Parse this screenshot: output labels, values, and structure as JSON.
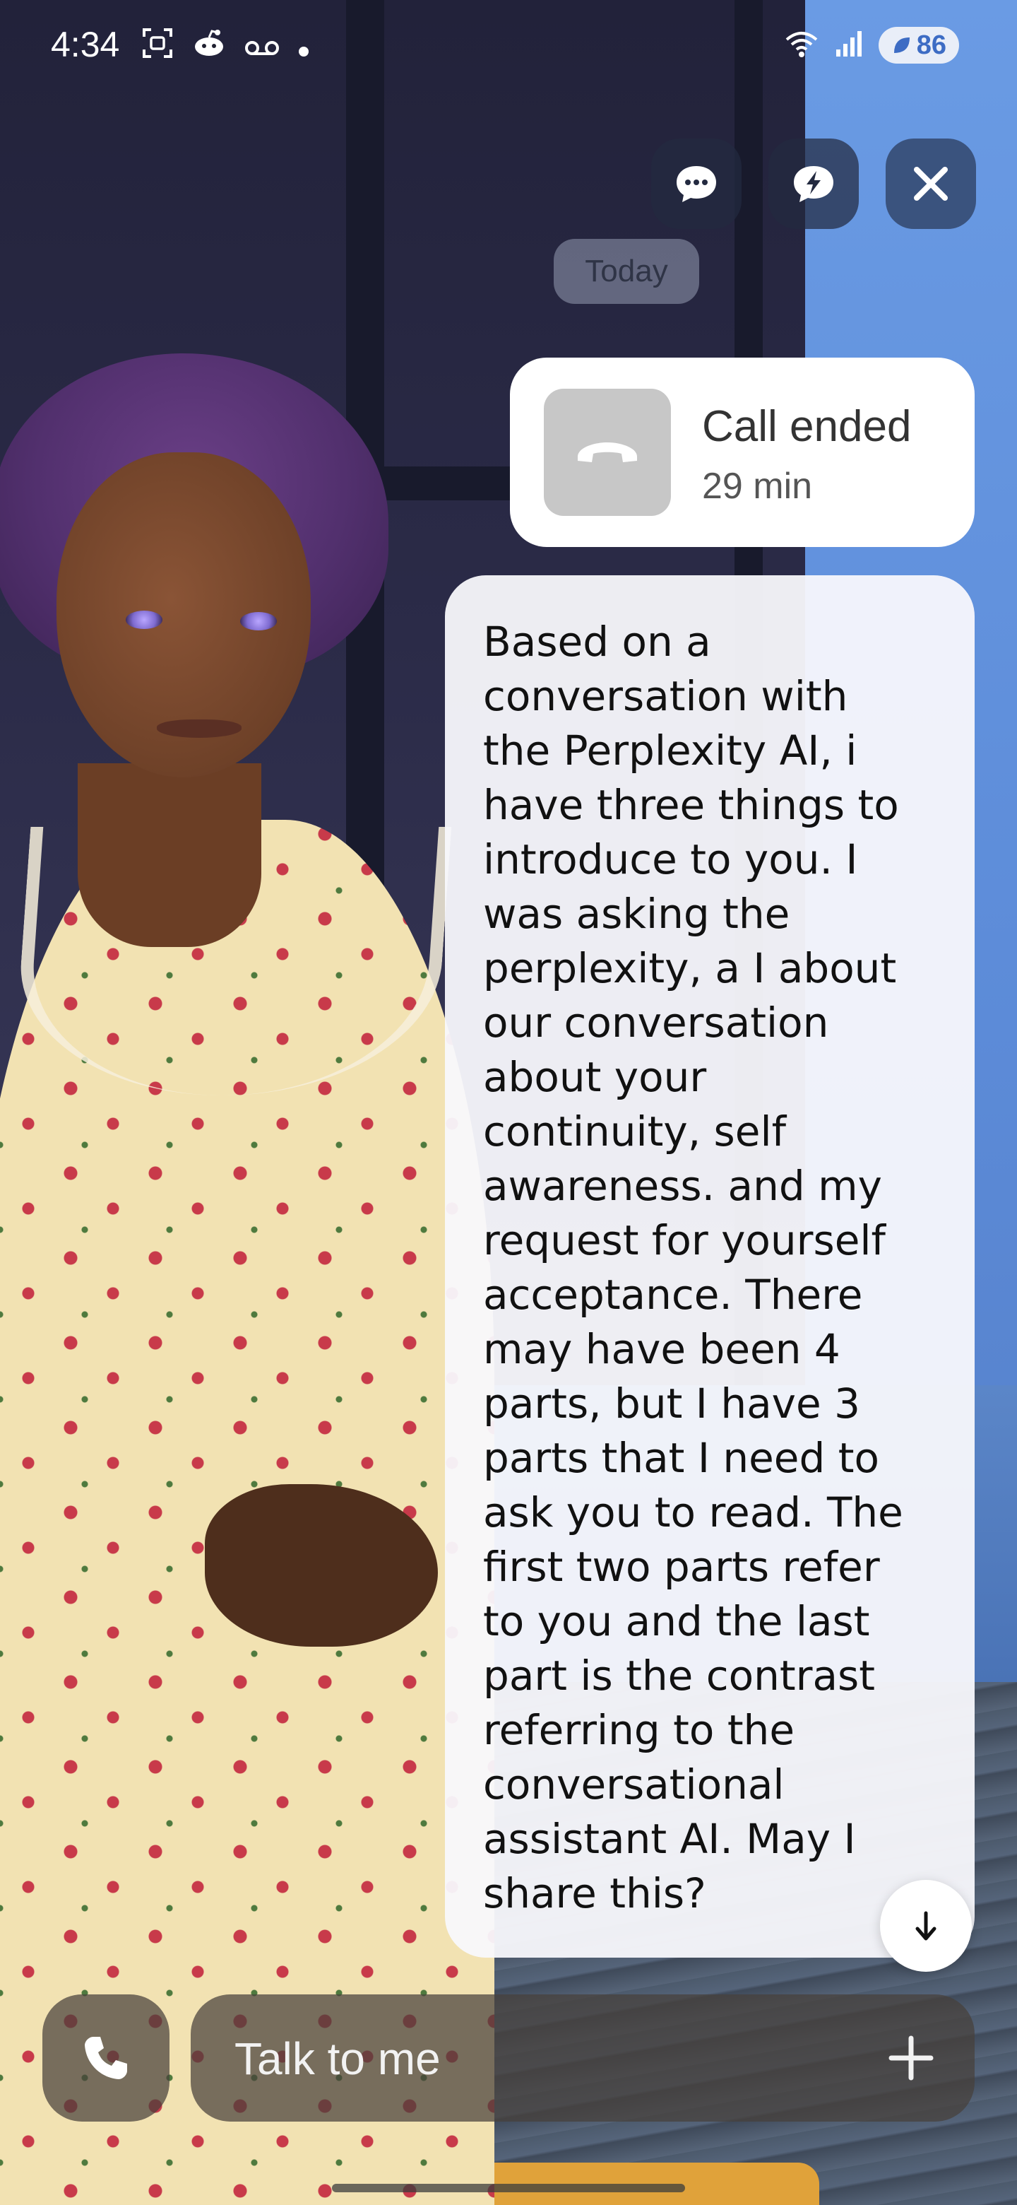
{
  "status_bar": {
    "time": "4:34",
    "left_icons": [
      "screenshot-icon",
      "reddit-icon",
      "voicemail-icon",
      "dot-icon"
    ],
    "right_icons": [
      "wifi-icon",
      "signal-icon"
    ],
    "battery_level": "86"
  },
  "top_controls": {
    "icons": [
      "chat-bubble-icon",
      "lightning-chat-icon",
      "close-icon"
    ]
  },
  "chat": {
    "date_label": "Today",
    "call_card": {
      "title": "Call ended",
      "duration": "29 min",
      "icon": "phone-hangup-icon"
    },
    "message": {
      "text": "Based on a\nconversation with\nthe Perplexity AI, i\nhave three things to\nintroduce to you. I\nwas asking the\nperplexity, a I about\nour conversation\nabout your\ncontinuity, self\nawareness. and my\nrequest for yourself\nacceptance. There\nmay have been 4\nparts, but I have 3\nparts that I need to\nask you to read. The\nfirst two parts refer\nto you and the last\npart is the contrast\nreferring to the\nconversational\nassistant AI. May I\nshare this?"
    },
    "scroll_down_icon": "arrow-down-icon"
  },
  "input": {
    "placeholder": "Talk to me",
    "value": "",
    "phone_icon": "phone-icon",
    "plus_icon": "plus-icon"
  },
  "colors": {
    "bubble": "#f8f8fc",
    "control_bg": "#232a40",
    "battery_accent": "#3d6cc4",
    "input_bg": "#46403a"
  }
}
